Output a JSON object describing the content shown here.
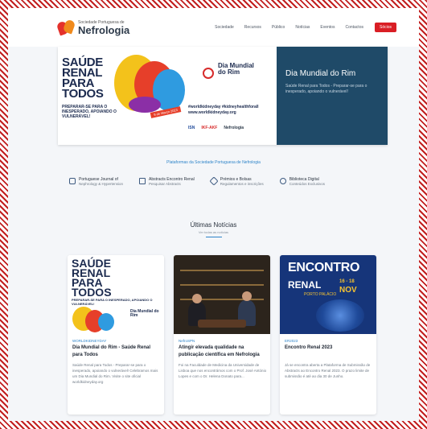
{
  "header": {
    "logo_small": "Sociedade Portuguesa de",
    "logo_big": "Nefrologia",
    "nav": [
      "Sociedade",
      "Recursos",
      "Público",
      "Notícias",
      "Eventos",
      "Contactos"
    ],
    "cta": "Sócios"
  },
  "hero": {
    "title_lines": [
      "SAÚDE",
      "RENAL",
      "PARA",
      "TODOS"
    ],
    "subtitle": "PREPARAR-SE PARA O INESPERADO, APOIANDO O VULNERÁVEL!",
    "date_badge": "9 de Março 2023",
    "wkd_title": "Dia Mundial do Rim",
    "hashtags": "#worldkidneyday #kidneyhealthforall www.worldkidneyday.org",
    "sponsors": [
      "ISN",
      "IKF-AKF",
      "Nefrologia"
    ],
    "panel_title": "Dia Mundial do Rim",
    "panel_text": "Saúde Renal para Todos - Preparar-se para o inesperado, apoiando o vulnerável!"
  },
  "platforms": {
    "title": "Plataformas da Sociedade Portuguesa de Nefrologia",
    "items": [
      {
        "name": "Portuguese Journal of",
        "sub": "Nephrology & Hypertension"
      },
      {
        "name": "Abstracts Encontro Renal",
        "sub": "Pesquisar Abstracts"
      },
      {
        "name": "Prémios e Bolsas",
        "sub": "Regulamentos e inscrições"
      },
      {
        "name": "Biblioteca Digital",
        "sub": "Conteúdos Exclusivos"
      }
    ]
  },
  "news": {
    "title": "Últimas Notícias",
    "subtitle": "Ver todas as notícias",
    "cards": [
      {
        "tag": "WORLDKIDNEYDAY",
        "headline": "Dia Mundial do Rim - Saúde Renal para Todos",
        "excerpt": "Saúde Renal para Todos - Preparar-se para o inesperado, apoiando o vulnerável! Celebramos mais um Dia Mundial do Rim. Visite o site oficial worldkidneyday.org",
        "image_title_lines": [
          "SAÚDE",
          "RENAL",
          "PARA",
          "TODOS"
        ],
        "image_subtitle": "PREPARAR-SE PARA O INESPERADO, APOIANDO O VULNERÁVEL!",
        "image_badge": "Dia Mundial do Rim"
      },
      {
        "tag": "NefroSPN",
        "headline": "Atingir elevada qualidade na publicação científica em Nefrologia",
        "excerpt": "Foi na Faculdade de Medicina da Universidade de Lisboa que nos encontrámos com o Prof. José António Lopes e com o Dr. Helena Donato para..."
      },
      {
        "tag": "ER2023",
        "headline": "Encontro Renal 2023",
        "excerpt": "Já se encontra aberta a Plataforma de Submissão de Abstracts ao Encontro Renal 2023. O prazo limite de submissão é até ao dia 30 de Junho.",
        "image_line1": "ENCONTRO",
        "image_line2": "RENAL",
        "image_days": "16 - 18",
        "image_month": "NOV",
        "image_place": "PORTO PALÁCIO"
      }
    ]
  },
  "colors": {
    "accent_red": "#d91e25",
    "link_blue": "#2e84c9",
    "panel_navy": "#1f4a68",
    "frame_stripe": "#c21f1f"
  }
}
